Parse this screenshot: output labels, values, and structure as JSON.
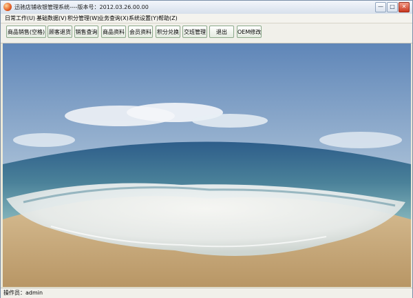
{
  "window": {
    "title": "迅驰店铺收银管理系统----版本号：2012.03.26.00.00",
    "controls": {
      "minimize": "—",
      "maximize": "□",
      "close": "✕"
    }
  },
  "menu": [
    {
      "label": "日常工作(U)"
    },
    {
      "label": "基础数据(V)"
    },
    {
      "label": "积分管理(W)"
    },
    {
      "label": "业务查询(X)"
    },
    {
      "label": "系统设置(Y)"
    },
    {
      "label": "帮助(Z)"
    }
  ],
  "toolbar": [
    {
      "label": "商品销售(空格)"
    },
    {
      "label": "顾客退货"
    },
    {
      "label": "销售查询"
    },
    {
      "label": "商品资料"
    },
    {
      "label": "会员资料"
    },
    {
      "label": "积分兑换"
    },
    {
      "label": "交班管理"
    },
    {
      "label": "退出"
    },
    {
      "label": "OEM修改"
    }
  ],
  "status": {
    "operator": "操作员：admin"
  },
  "colors": {
    "frame": "#7a8ea8",
    "button_border": "#8aa889",
    "close_button": "#c8371f"
  }
}
